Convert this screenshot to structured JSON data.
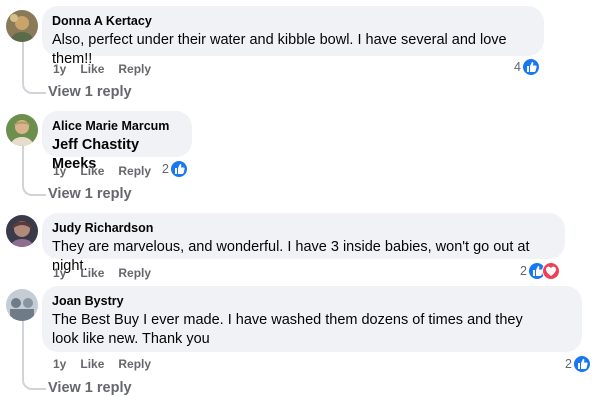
{
  "comments": [
    {
      "author": "Donna A Kertacy",
      "text": "Also, perfect under their water and kibble bowl. I have several and love them!!",
      "time": "1y",
      "like": "Like",
      "reply": "Reply",
      "reaction_count": "4",
      "view_replies": "View 1 reply",
      "avatar_colors": [
        "#8a7a5a",
        "#c9a46a"
      ]
    },
    {
      "author": "Alice Marie Marcum",
      "text": "Jeff Chastity Meeks",
      "time": "1y",
      "like": "Like",
      "reply": "Reply",
      "reaction_count": "2",
      "view_replies": "View 1 reply",
      "avatar_colors": [
        "#6d8f4e",
        "#d7b48c"
      ]
    },
    {
      "author": "Judy Richardson",
      "text": "They are marvelous, and wonderful. I have 3 inside babies, won't go out at night.",
      "time": "1y",
      "like": "Like",
      "reply": "Reply",
      "reaction_count": "2",
      "avatar_colors": [
        "#3b3a4a",
        "#8e6d8f"
      ]
    },
    {
      "author": "Joan Bystry",
      "text": "The Best Buy I ever made. I have washed them dozens of times and they look like new. Thank you",
      "time": "1y",
      "like": "Like",
      "reply": "Reply",
      "reaction_count": "2",
      "view_replies": "View 1 reply",
      "avatar_colors": [
        "#6f7b86",
        "#c4ccd4"
      ]
    }
  ],
  "colors": {
    "bubble": "#f0f2f5",
    "like_blue": "#1877f2",
    "love_red": "#f33e58",
    "meta_gray": "#65676b"
  }
}
